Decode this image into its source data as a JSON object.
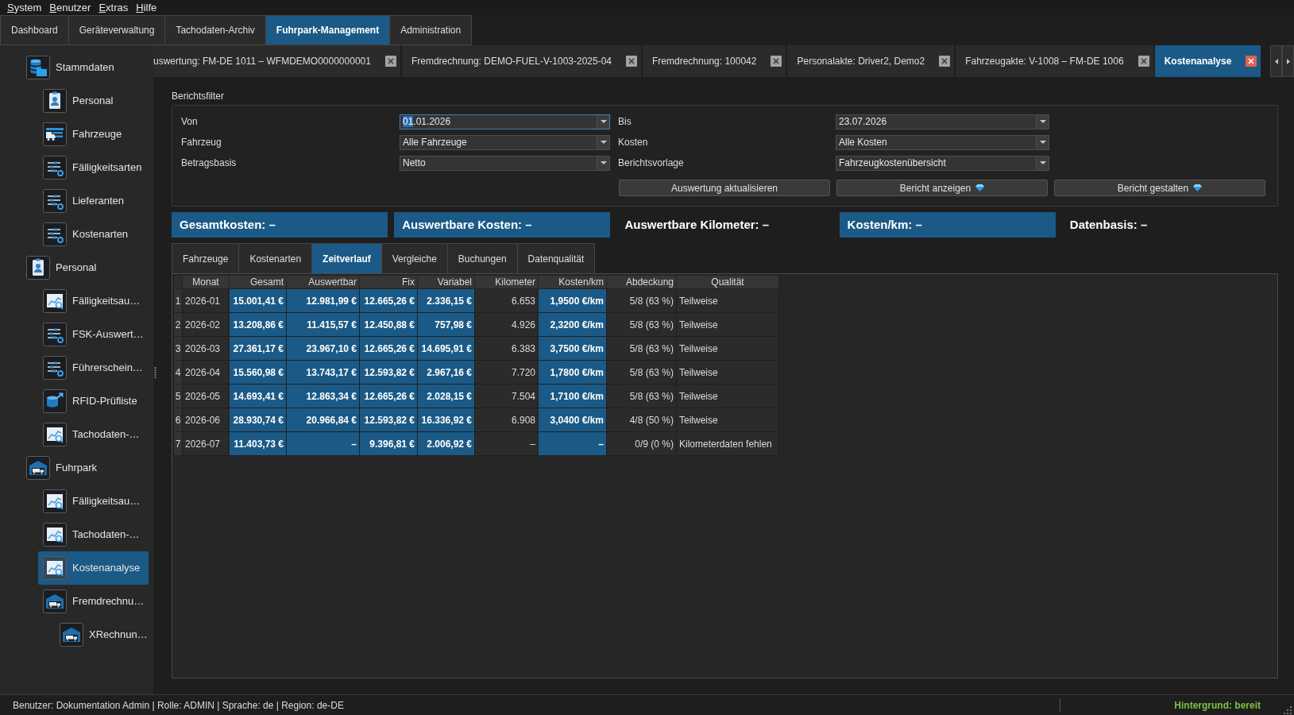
{
  "menu": [
    "System",
    "Benutzer",
    "Extras",
    "Hilfe"
  ],
  "main_tabs": [
    {
      "label": "Dashboard",
      "selected": false
    },
    {
      "label": "Geräteverwaltung",
      "selected": false
    },
    {
      "label": "Tachodaten-Archiv",
      "selected": false
    },
    {
      "label": "Fuhrpark-Management",
      "selected": true
    },
    {
      "label": "Administration",
      "selected": false
    }
  ],
  "sidebar": {
    "items": [
      {
        "label": "Stammdaten",
        "kind": "database",
        "selected": false,
        "children": [
          {
            "label": "Personal",
            "kind": "badge",
            "selected": false
          },
          {
            "label": "Fahrzeuge",
            "kind": "vehicle",
            "selected": false
          },
          {
            "label": "Fälligkeitsarten",
            "kind": "list",
            "selected": false
          },
          {
            "label": "Lieferanten",
            "kind": "list",
            "selected": false
          },
          {
            "label": "Kostenarten",
            "kind": "list",
            "selected": false
          }
        ]
      },
      {
        "label": "Personal",
        "kind": "badge",
        "selected": false,
        "children": [
          {
            "label": "Fälligkeitsau…",
            "kind": "chart",
            "selected": false
          },
          {
            "label": "FSK-Auswert…",
            "kind": "list",
            "selected": false
          },
          {
            "label": "Führerschein…",
            "kind": "list",
            "selected": false
          },
          {
            "label": "RFID-Prüfliste",
            "kind": "export",
            "selected": false
          },
          {
            "label": "Tachodaten-…",
            "kind": "chart",
            "selected": false
          }
        ]
      },
      {
        "label": "Fuhrpark",
        "kind": "garage",
        "selected": false,
        "children": [
          {
            "label": "Fälligkeitsau…",
            "kind": "chart",
            "selected": false
          },
          {
            "label": "Tachodaten-…",
            "kind": "chart",
            "selected": false
          },
          {
            "label": "Kostenanalyse",
            "kind": "chart",
            "selected": true
          },
          {
            "label": "Fremdrechnu…",
            "kind": "garage",
            "selected": false,
            "children": [
              {
                "label": "XRechnun…",
                "kind": "garage",
                "selected": false
              }
            ]
          }
        ]
      }
    ]
  },
  "document_tabs": [
    {
      "label": "uswertung: FM-DE 1011 – WFMDEMO0000000001",
      "selected": false
    },
    {
      "label": "Fremdrechnung: DEMO-FUEL-V-1003-2025-04",
      "selected": false
    },
    {
      "label": "Fremdrechnung: 100042",
      "selected": false
    },
    {
      "label": "Personalakte: Driver2, Demo2",
      "selected": false
    },
    {
      "label": "Fahrzeugakte: V-1008 – FM-DE 1006",
      "selected": false
    },
    {
      "label": "Kostenanalyse",
      "selected": true
    }
  ],
  "report_filter": {
    "title": "Berichtsfilter",
    "fields": [
      {
        "label": "Von",
        "value": "01.01.2026",
        "focused": true
      },
      {
        "label": "Bis",
        "value": "23.07.2026",
        "focused": false
      },
      {
        "label": "Fahrzeug",
        "value": "Alle Fahrzeuge",
        "focused": false
      },
      {
        "label": "Kosten",
        "value": "Alle Kosten",
        "focused": false
      },
      {
        "label": "Betragsbasis",
        "value": "Netto",
        "focused": false
      },
      {
        "label": "Berichtsvorlage",
        "value": "Fahrzeugkostenübersicht",
        "focused": false
      }
    ],
    "buttons": [
      {
        "label": "Auswertung aktualisieren",
        "kind": "plain"
      },
      {
        "label": "Bericht anzeigen",
        "kind": "gem"
      },
      {
        "label": "Bericht gestalten",
        "kind": "gem"
      }
    ]
  },
  "summary": [
    {
      "label": "Gesamtkosten: –",
      "highlighted": true
    },
    {
      "label": "Auswertbare Kosten: –",
      "highlighted": true
    },
    {
      "label": "Auswertbare Kilometer: –",
      "highlighted": false
    },
    {
      "label": "Kosten/km: –",
      "highlighted": true
    },
    {
      "label": "Datenbasis: –",
      "highlighted": false
    }
  ],
  "result_tabs": [
    {
      "label": "Fahrzeuge",
      "selected": false
    },
    {
      "label": "Kostenarten",
      "selected": false
    },
    {
      "label": "Zeitverlauf",
      "selected": true
    },
    {
      "label": "Vergleiche",
      "selected": false
    },
    {
      "label": "Buchungen",
      "selected": false
    },
    {
      "label": "Datenqualität",
      "selected": false
    }
  ],
  "table": {
    "columns": [
      {
        "label": "Monat",
        "kind": "text",
        "highlighted": false
      },
      {
        "label": "Gesamt",
        "kind": "number",
        "highlighted": true
      },
      {
        "label": "Auswertbar",
        "kind": "number",
        "highlighted": true
      },
      {
        "label": "Fix",
        "kind": "number",
        "highlighted": true
      },
      {
        "label": "Variabel",
        "kind": "number",
        "highlighted": true
      },
      {
        "label": "Kilometer",
        "kind": "number",
        "highlighted": false
      },
      {
        "label": "Kosten/km",
        "kind": "number",
        "highlighted": true
      },
      {
        "label": "Abdeckung",
        "kind": "number",
        "highlighted": false
      },
      {
        "label": "Qualität",
        "kind": "text",
        "highlighted": false
      }
    ],
    "rows": [
      {
        "number": "1",
        "cells": [
          "2026-01",
          "15.001,41 €",
          "12.981,99 €",
          "12.665,26 €",
          "2.336,15 €",
          "6.653",
          "1,9500 €/km",
          "5/8 (63 %)",
          "Teilweise"
        ]
      },
      {
        "number": "2",
        "cells": [
          "2026-02",
          "13.208,86 €",
          "11.415,57 €",
          "12.450,88 €",
          "757,98 €",
          "4.926",
          "2,3200 €/km",
          "5/8 (63 %)",
          "Teilweise"
        ]
      },
      {
        "number": "3",
        "cells": [
          "2026-03",
          "27.361,17 €",
          "23.967,10 €",
          "12.665,26 €",
          "14.695,91 €",
          "6.383",
          "3,7500 €/km",
          "5/8 (63 %)",
          "Teilweise"
        ]
      },
      {
        "number": "4",
        "cells": [
          "2026-04",
          "15.560,98 €",
          "13.743,17 €",
          "12.593,82 €",
          "2.967,16 €",
          "7.720",
          "1,7800 €/km",
          "5/8 (63 %)",
          "Teilweise"
        ]
      },
      {
        "number": "5",
        "cells": [
          "2026-05",
          "14.693,41 €",
          "12.863,34 €",
          "12.665,26 €",
          "2.028,15 €",
          "7.504",
          "1,7100 €/km",
          "5/8 (63 %)",
          "Teilweise"
        ]
      },
      {
        "number": "6",
        "cells": [
          "2026-06",
          "28.930,74 €",
          "20.966,84 €",
          "12.593,82 €",
          "16.336,92 €",
          "6.908",
          "3,0400 €/km",
          "4/8 (50 %)",
          "Teilweise"
        ]
      },
      {
        "number": "7",
        "cells": [
          "2026-07",
          "11.403,73 €",
          "–",
          "9.396,81 €",
          "2.006,92 €",
          "–",
          "–",
          "0/9 (0 %)",
          "Kilometerdaten fehlen"
        ]
      }
    ]
  },
  "status_bar": {
    "text": "Benutzer: Dokumentation Admin | Rolle: ADMIN | Sprache: de | Region: de-DE",
    "background_status": "Hintergrund: bereit"
  }
}
